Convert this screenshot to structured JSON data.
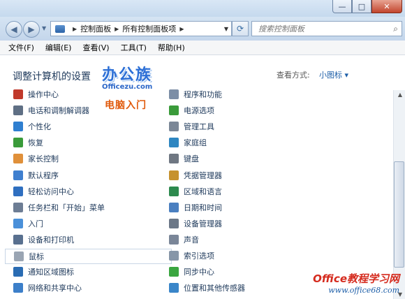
{
  "nav": {
    "breadcrumb": [
      "控制面板",
      "所有控制面板项"
    ],
    "search_placeholder": "搜索控制面板"
  },
  "menu": [
    "文件(F)",
    "编辑(E)",
    "查看(V)",
    "工具(T)",
    "帮助(H)"
  ],
  "header": {
    "title": "调整计算机的设置",
    "view_label": "查看方式:",
    "view_value": "小图标 ▾"
  },
  "logo": {
    "text": "办公族",
    "url": "Officezu.com",
    "tagline": "电脑入门"
  },
  "left_items": [
    {
      "label": "操作中心",
      "color": "#c0392b"
    },
    {
      "label": "电话和调制解调器",
      "color": "#5f6f84"
    },
    {
      "label": "个性化",
      "color": "#2f7fd0"
    },
    {
      "label": "恢复",
      "color": "#3a9b3a"
    },
    {
      "label": "家长控制",
      "color": "#e0903a"
    },
    {
      "label": "默认程序",
      "color": "#3f7fcf"
    },
    {
      "label": "轻松访问中心",
      "color": "#2f6fc0"
    },
    {
      "label": "任务栏和「开始」菜单",
      "color": "#6d7d94"
    },
    {
      "label": "入门",
      "color": "#4a90d9"
    },
    {
      "label": "设备和打印机",
      "color": "#59708f"
    },
    {
      "label": "鼠标",
      "color": "#9aa5b3",
      "selected": true
    },
    {
      "label": "通知区域图标",
      "color": "#2a6cb3"
    },
    {
      "label": "网络和共享中心",
      "color": "#3c7fc9"
    }
  ],
  "right_items": [
    {
      "label": "程序和功能",
      "color": "#7c8ea6"
    },
    {
      "label": "电源选项",
      "color": "#3a9b3a"
    },
    {
      "label": "管理工具",
      "color": "#7b8797"
    },
    {
      "label": "家庭组",
      "color": "#2e86c1"
    },
    {
      "label": "键盘",
      "color": "#6f7782"
    },
    {
      "label": "凭据管理器",
      "color": "#c6922e"
    },
    {
      "label": "区域和语言",
      "color": "#2d8a4e"
    },
    {
      "label": "日期和时间",
      "color": "#4a7fc0"
    },
    {
      "label": "设备管理器",
      "color": "#6b7787"
    },
    {
      "label": "声音",
      "color": "#7a8698"
    },
    {
      "label": "索引选项",
      "color": "#8796a8"
    },
    {
      "label": "同步中心",
      "color": "#3aa640"
    },
    {
      "label": "位置和其他传感器",
      "color": "#3a86c9"
    }
  ],
  "watermark": {
    "brand": "Office教程学习网",
    "url": "www.office68.com"
  }
}
